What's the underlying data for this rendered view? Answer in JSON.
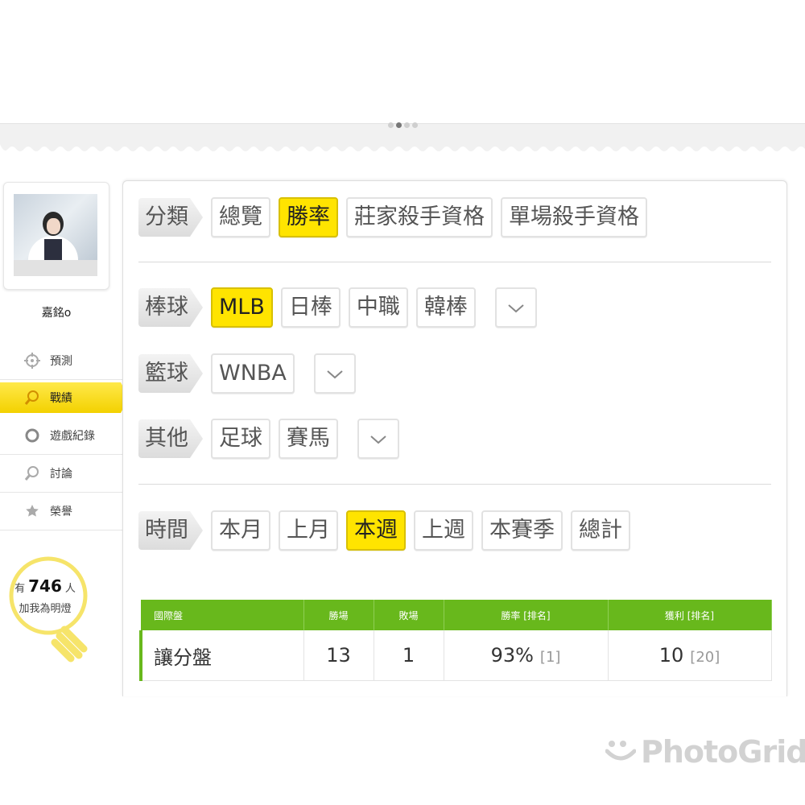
{
  "sidebar": {
    "username": "嘉銘o",
    "menu": [
      {
        "label": "預測",
        "icon": "crosshair-icon"
      },
      {
        "label": "戰績",
        "icon": "magnifier-icon",
        "active": true
      },
      {
        "label": "遊戲紀錄",
        "icon": "circle-icon"
      },
      {
        "label": "討論",
        "icon": "search-icon"
      },
      {
        "label": "榮譽",
        "icon": "medal-icon"
      }
    ],
    "bulb": {
      "prefix": "有",
      "count": "746",
      "suffix": "人",
      "line2": "加我為明燈"
    }
  },
  "filters": {
    "category": {
      "label": "分類",
      "options": [
        "總覽",
        "勝率",
        "莊家殺手資格",
        "單場殺手資格"
      ],
      "selected": "勝率"
    },
    "baseball": {
      "label": "棒球",
      "options": [
        "MLB",
        "日棒",
        "中職",
        "韓棒"
      ],
      "selected": "MLB"
    },
    "basketball": {
      "label": "籃球",
      "options": [
        "WNBA"
      ],
      "selected": ""
    },
    "other": {
      "label": "其他",
      "options": [
        "足球",
        "賽馬"
      ],
      "selected": ""
    },
    "time": {
      "label": "時間",
      "options": [
        "本月",
        "上月",
        "本週",
        "上週",
        "本賽季",
        "總計"
      ],
      "selected": "本週"
    }
  },
  "table": {
    "headers": [
      "國際盤",
      "勝場",
      "敗場",
      "勝率 [排名]",
      "獲利 [排名]"
    ],
    "rows": [
      {
        "type": "讓分盤",
        "wins": "13",
        "losses": "1",
        "rate": "93%",
        "rate_rank": "[1]",
        "profit": "10",
        "profit_rank": "[20]"
      }
    ]
  },
  "watermark": "PhotoGrid",
  "colors": {
    "accent_yellow": "#ffe400",
    "header_green": "#68b81c",
    "active_menu": "#f3d100"
  }
}
